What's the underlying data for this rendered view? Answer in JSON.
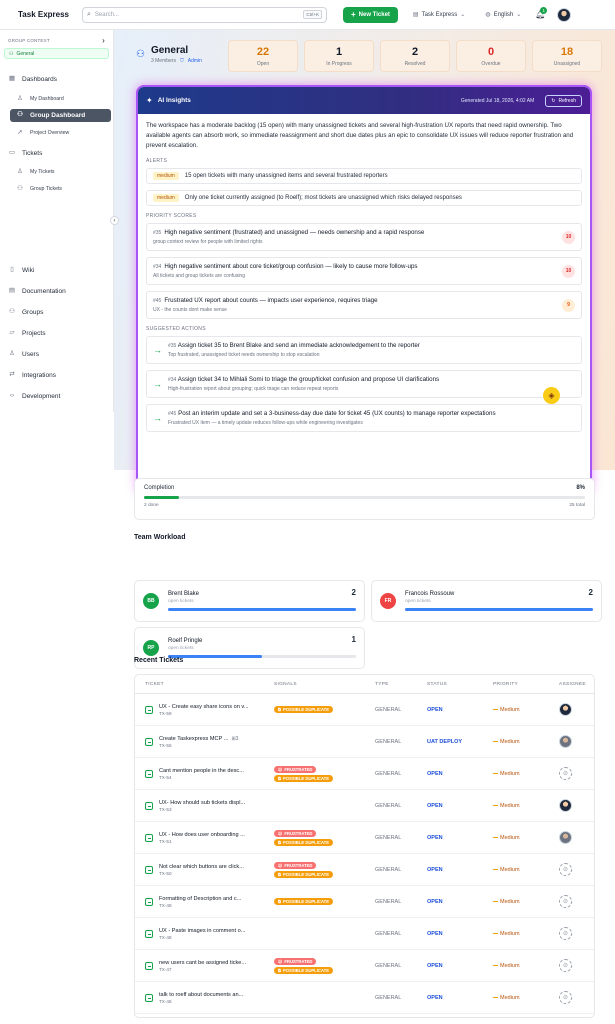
{
  "app": {
    "title": "Task Express"
  },
  "topbar": {
    "search_placeholder": "Search...",
    "shortcut": "Ctrl+K",
    "new_ticket": "New Ticket",
    "workspace": "Task Express",
    "language": "English",
    "notif_count": "1"
  },
  "sidebar": {
    "group_context_label": "GROUP CONTEXT",
    "group": "General",
    "dashboards": "Dashboards",
    "my_dashboard": "My Dashboard",
    "group_dashboard": "Group Dashboard",
    "project_overview": "Project Overview",
    "tickets": "Tickets",
    "my_tickets": "My Tickets",
    "group_tickets": "Group Tickets",
    "wiki": "Wiki",
    "documentation": "Documentation",
    "groups": "Groups",
    "projects": "Projects",
    "users": "Users",
    "integrations": "Integrations",
    "development": "Development"
  },
  "group": {
    "name": "General",
    "members": "3 Members",
    "role": "Admin"
  },
  "stats": [
    {
      "value": "22",
      "label": "Open",
      "color": "#d97706"
    },
    {
      "value": "1",
      "label": "In Progress",
      "color": "#111827"
    },
    {
      "value": "2",
      "label": "Resolved",
      "color": "#111827"
    },
    {
      "value": "0",
      "label": "Overdue",
      "color": "#dc2626"
    },
    {
      "value": "18",
      "label": "Unassigned",
      "color": "#d97706"
    }
  ],
  "ai": {
    "title": "AI Insights",
    "generated": "Generated Jul 18, 2026, 4:02 AM",
    "refresh": "Refresh",
    "summary": "The workspace has a moderate backlog (15 open) with many unassigned tickets and several high-frustration UX reports that need rapid ownership. Two available agents can absorb work, so immediate reassignment and short due dates plus an epic to consolidate UX issues will reduce reporter frustration and prevent escalation.",
    "alerts_label": "ALERTS",
    "alerts": [
      {
        "level": "medium",
        "text": "15 open tickets with many unassigned items and several frustrated reporters"
      },
      {
        "level": "medium",
        "text": "Only one ticket currently assigned (to Roelf); most tickets are unassigned which risks delayed responses"
      }
    ],
    "priority_label": "PRIORITY SCORES",
    "priorities": [
      {
        "id": "#35",
        "title": "High negative sentiment (frustrated) and unassigned — needs ownership and a rapid response",
        "sub": "group context review for people with limited rights",
        "score": "10"
      },
      {
        "id": "#34",
        "title": "High negative sentiment about core ticket/group confusion — likely to cause more follow-ups",
        "sub": "All tickets and group tickets are confusing",
        "score": "10"
      },
      {
        "id": "#45",
        "title": "Frustrated UX report about counts — impacts user experience, requires triage",
        "sub": "UX - the counts dont make sense",
        "score": "9"
      }
    ],
    "actions_label": "SUGGESTED ACTIONS",
    "actions": [
      {
        "id": "#35",
        "title": "Assign ticket 35 to Brent Blake and send an immediate acknowledgement to the reporter",
        "sub": "Top frustrated, unassigned ticket needs ownership to stop escalation"
      },
      {
        "id": "#34",
        "title": "Assign ticket 34 to Mihlali Somi to triage the group/ticket confusion and propose UI clarifications",
        "sub": "High-frustration report about grouping; quick triage can reduce repeat reports"
      },
      {
        "id": "#45",
        "title": "Post an interim update and set a 3-business-day due date for ticket 45 (UX counts) to manage reporter expectations",
        "sub": "Frustrated UX item — a timely update reduces follow-ups while engineering investigates"
      }
    ]
  },
  "completion": {
    "label": "Completion",
    "percent": "8%",
    "fraction": 0.08,
    "done": "2 done",
    "total": "25 total"
  },
  "workload": {
    "title": "Team Workload",
    "members": [
      {
        "initials": "BB",
        "name": "Brent Blake",
        "sub": "open tickets",
        "count": "2",
        "fill": 1.0,
        "color": "#16a34a"
      },
      {
        "initials": "FR",
        "name": "Francois Rossouw",
        "sub": "open tickets",
        "count": "2",
        "fill": 1.0,
        "color": "#ef4444"
      },
      {
        "initials": "RP",
        "name": "Roelf Pringle",
        "sub": "open tickets",
        "count": "1",
        "fill": 0.5,
        "color": "#16a34a"
      }
    ]
  },
  "recent": {
    "title": "Recent Tickets",
    "headers": [
      "TICKET",
      "SIGNALS",
      "TYPE",
      "STATUS",
      "PRIORITY",
      "ASSIGNEE"
    ],
    "rows": [
      {
        "title": "UX - Create easy share icons on v...",
        "key": "TX-59",
        "signals": [
          "POSSIBLE DUPLICATE"
        ],
        "type": "GENERAL",
        "status": "OPEN",
        "priority": "Medium",
        "assignee": "dark"
      },
      {
        "title": "Create Taskexpress MCP ...",
        "key": "TX-55",
        "signals": [],
        "extra": "3",
        "type": "GENERAL",
        "status": "UAT DEPLOY",
        "priority": "Medium",
        "assignee": "grey"
      },
      {
        "title": "Cant mention people in the desc...",
        "key": "TX-54",
        "signals": [
          "FRUSTRATED",
          "POSSIBLE DUPLICATE"
        ],
        "type": "GENERAL",
        "status": "OPEN",
        "priority": "Medium",
        "assignee": "none"
      },
      {
        "title": "UX- How should sub tickets displ...",
        "key": "TX-53",
        "signals": [],
        "type": "GENERAL",
        "status": "OPEN",
        "priority": "Medium",
        "assignee": "dark"
      },
      {
        "title": "UX - How does user onboarding ...",
        "key": "TX-51",
        "signals": [
          "FRUSTRATED",
          "POSSIBLE DUPLICATE"
        ],
        "type": "GENERAL",
        "status": "OPEN",
        "priority": "Medium",
        "assignee": "grey"
      },
      {
        "title": "Not clear which buttons are click...",
        "key": "TX-50",
        "signals": [
          "FRUSTRATED",
          "POSSIBLE DUPLICATE"
        ],
        "type": "GENERAL",
        "status": "OPEN",
        "priority": "Medium",
        "assignee": "none"
      },
      {
        "title": "Formatting of Description and c...",
        "key": "TX-49",
        "signals": [
          "POSSIBLE DUPLICATE"
        ],
        "type": "GENERAL",
        "status": "OPEN",
        "priority": "Medium",
        "assignee": "none"
      },
      {
        "title": "UX - Paste images in comment o...",
        "key": "TX-48",
        "signals": [],
        "type": "GENERAL",
        "status": "OPEN",
        "priority": "Medium",
        "assignee": "none"
      },
      {
        "title": "new users cant be assigned ticke...",
        "key": "TX-47",
        "signals": [
          "FRUSTRATED",
          "POSSIBLE DUPLICATE"
        ],
        "type": "GENERAL",
        "status": "OPEN",
        "priority": "Medium",
        "assignee": "none"
      },
      {
        "title": "talk to roelf about documents an...",
        "key": "TX-46",
        "signals": [],
        "type": "GENERAL",
        "status": "OPEN",
        "priority": "Medium",
        "assignee": "none"
      }
    ]
  }
}
